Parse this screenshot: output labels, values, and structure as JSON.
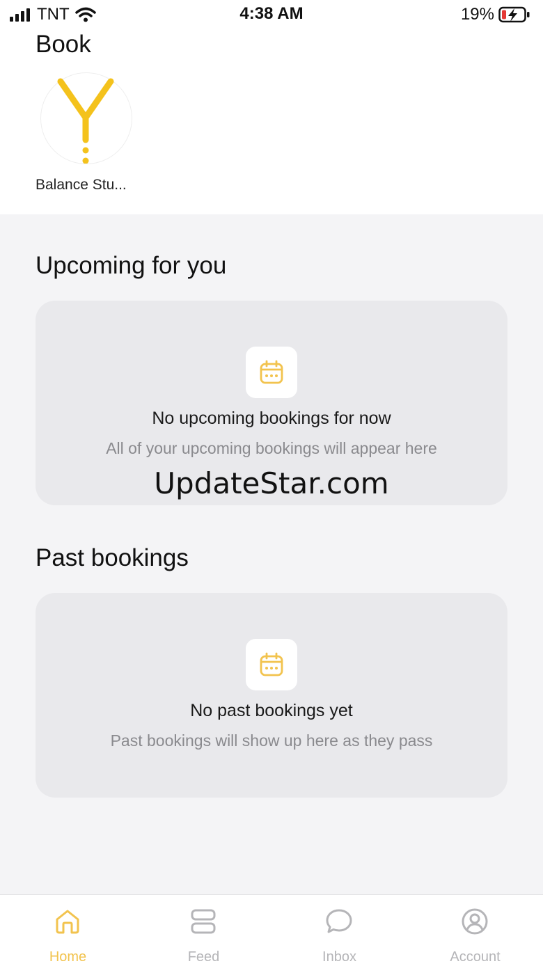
{
  "status_bar": {
    "carrier": "TNT",
    "time": "4:38 AM",
    "battery": "19%"
  },
  "book": {
    "title": "Book",
    "studio_name": "Balance Stu..."
  },
  "upcoming": {
    "heading": "Upcoming for you",
    "title": "No upcoming bookings for now",
    "subtitle": "All of your upcoming bookings will appear here"
  },
  "past": {
    "heading": "Past bookings",
    "title": "No past bookings yet",
    "subtitle": "Past bookings will show up here as they pass"
  },
  "watermark": "UpdateStar.com",
  "tabs": [
    {
      "label": "Home",
      "icon": "home-icon",
      "active": true
    },
    {
      "label": "Feed",
      "icon": "feed-icon",
      "active": false
    },
    {
      "label": "Inbox",
      "icon": "chat-icon",
      "active": false
    },
    {
      "label": "Account",
      "icon": "user-circle-icon",
      "active": false
    }
  ],
  "colors": {
    "accent": "#f2c34e",
    "logo_yellow": "#f4c21c",
    "inactive": "#b5b5b8",
    "card_bg": "#e9e9ec",
    "page_bg": "#f4f4f6"
  }
}
